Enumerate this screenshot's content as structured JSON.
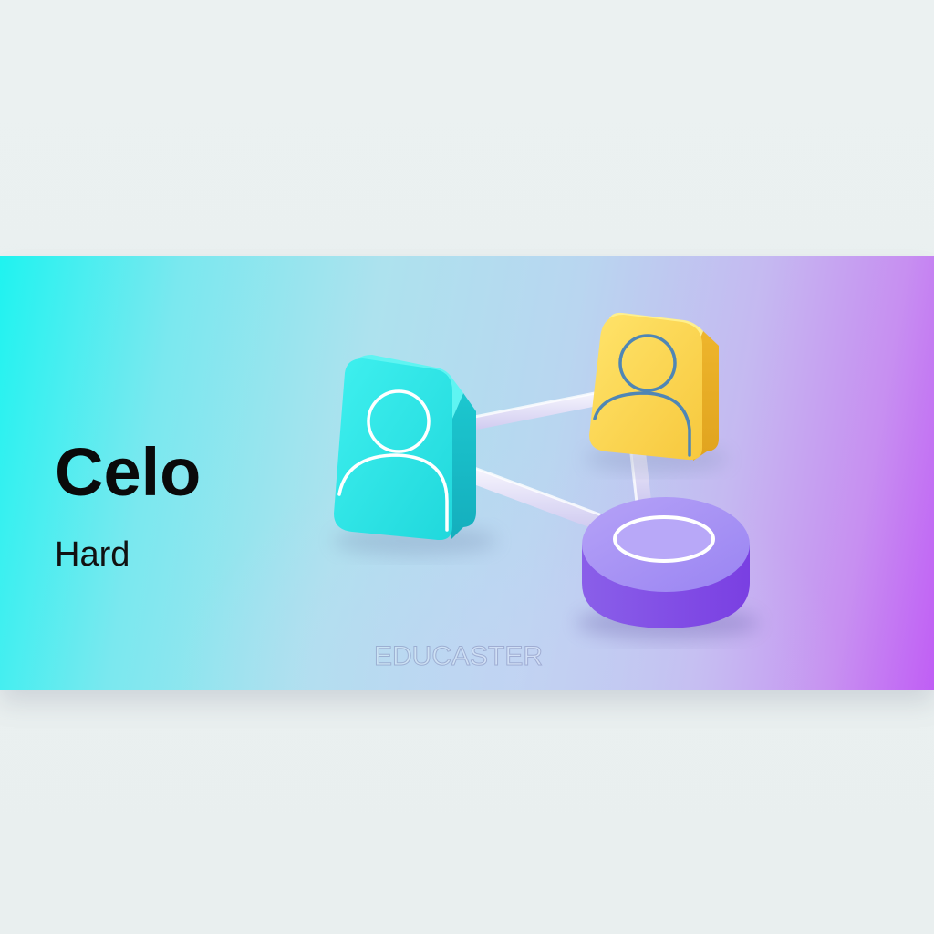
{
  "banner": {
    "title": "Celo",
    "subtitle": "Hard",
    "watermark": "EDUCASTER"
  },
  "illustration": {
    "nodes": [
      {
        "name": "user-node-left",
        "icon": "user-icon",
        "color": "#2ee6e6"
      },
      {
        "name": "user-node-right",
        "icon": "user-icon",
        "color": "#fbd955"
      },
      {
        "name": "hub-node",
        "icon": "ring-icon",
        "color": "#9b6cf0"
      }
    ],
    "connection_color": "#e6e4f7"
  },
  "colors": {
    "gradient_start": "#1ff3f0",
    "gradient_end": "#c05ef5",
    "title_color": "#0a0a0a"
  }
}
